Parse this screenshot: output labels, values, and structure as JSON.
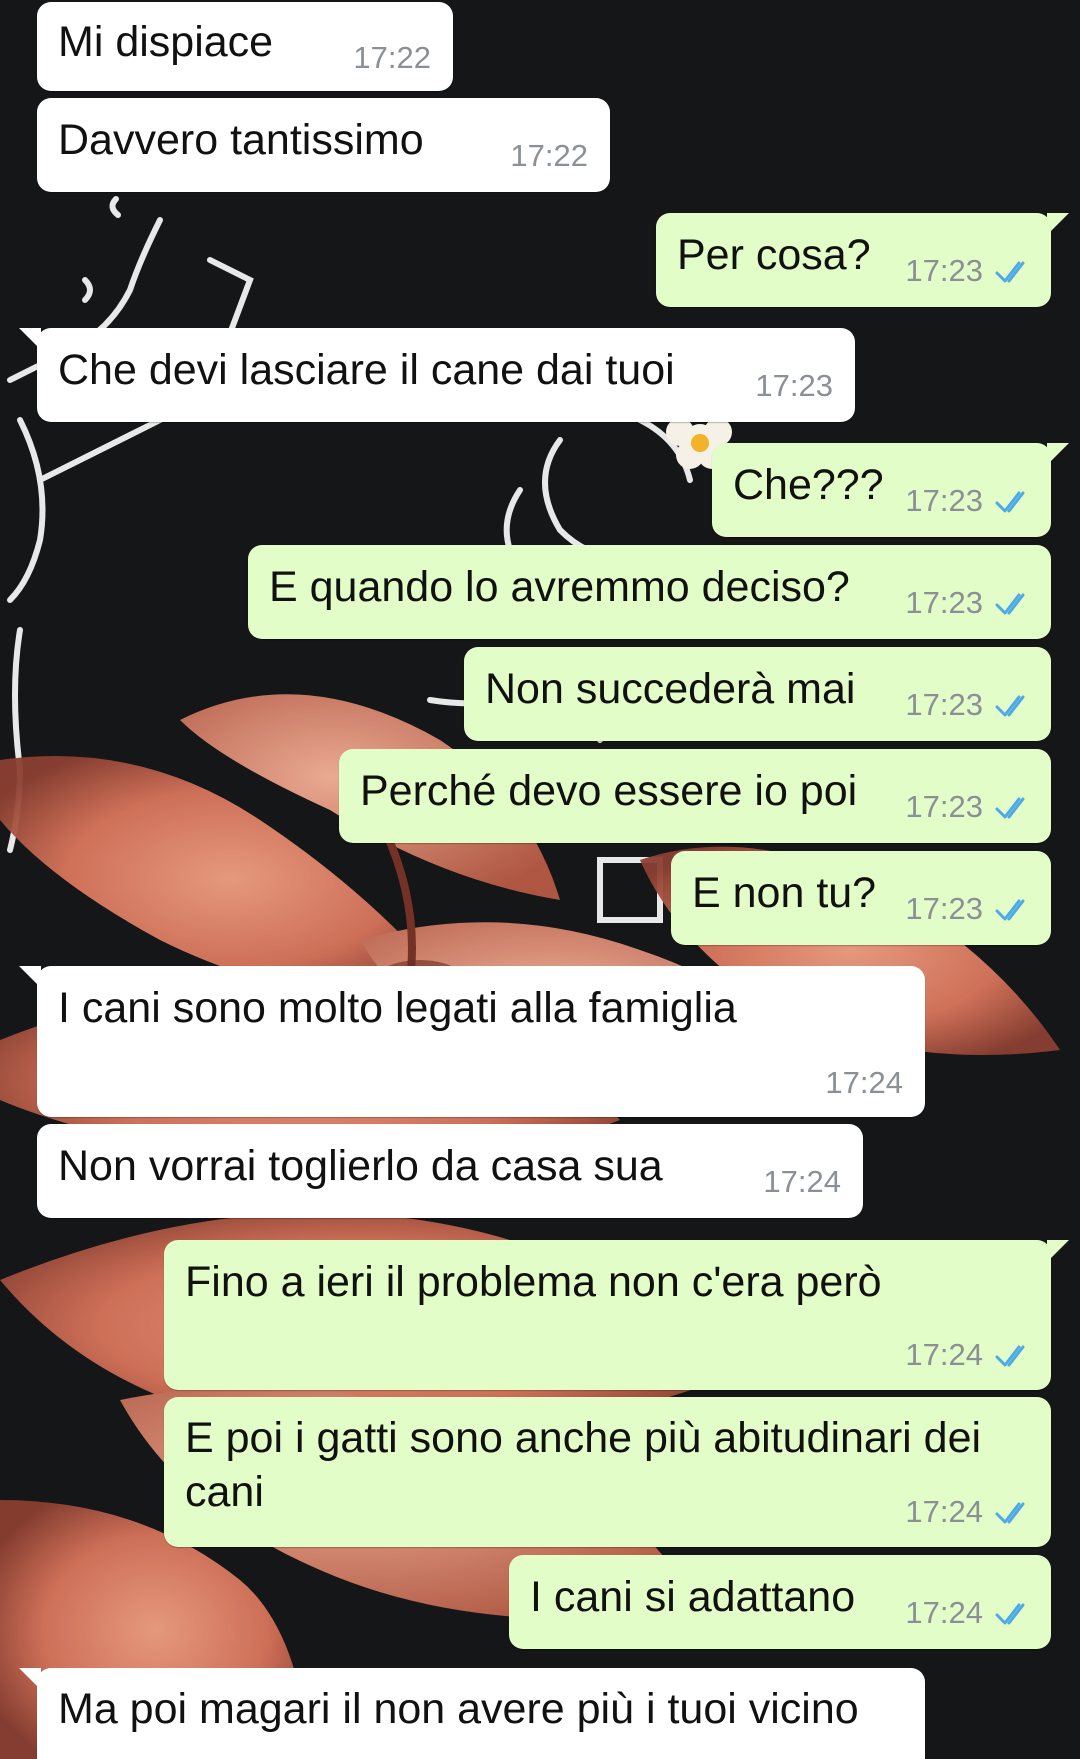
{
  "theme": {
    "incoming_bg": "#ffffff",
    "outgoing_bg": "#e2fdc8",
    "tick_color": "#4fa9e6",
    "wallpaper": "dark chalkboard with line drawing and salmon flower"
  },
  "messages": [
    {
      "dir": "in",
      "text": "Mi dispiace",
      "time": "17:22"
    },
    {
      "dir": "in",
      "text": "Davvero tantissimo",
      "time": "17:22"
    },
    {
      "dir": "out",
      "text": "Per cosa?",
      "time": "17:23",
      "status": "read"
    },
    {
      "dir": "in",
      "text": "Che devi lasciare il cane dai tuoi",
      "time": "17:23"
    },
    {
      "dir": "out",
      "text": "Che???",
      "time": "17:23",
      "status": "read"
    },
    {
      "dir": "out",
      "text": "E quando lo avremmo deciso?",
      "time": "17:23",
      "status": "read"
    },
    {
      "dir": "out",
      "text": "Non succederà mai",
      "time": "17:23",
      "status": "read"
    },
    {
      "dir": "out",
      "text": "Perché devo essere io poi",
      "time": "17:23",
      "status": "read"
    },
    {
      "dir": "out",
      "text": "E non tu?",
      "time": "17:23",
      "status": "read"
    },
    {
      "dir": "in",
      "text": "I cani sono molto legati alla famiglia",
      "time": "17:24"
    },
    {
      "dir": "in",
      "text": "Non vorrai toglierlo da casa sua",
      "time": "17:24"
    },
    {
      "dir": "out",
      "text": "Fino a ieri il problema non c'era però",
      "time": "17:24",
      "status": "read"
    },
    {
      "dir": "out",
      "text": "E poi i gatti sono anche più abitudinari dei cani",
      "time": "17:24",
      "status": "read"
    },
    {
      "dir": "out",
      "text": "I cani si adattano",
      "time": "17:24",
      "status": "read"
    },
    {
      "dir": "in",
      "text": "Ma poi magari il non avere più i tuoi vicino",
      "time": ""
    }
  ]
}
